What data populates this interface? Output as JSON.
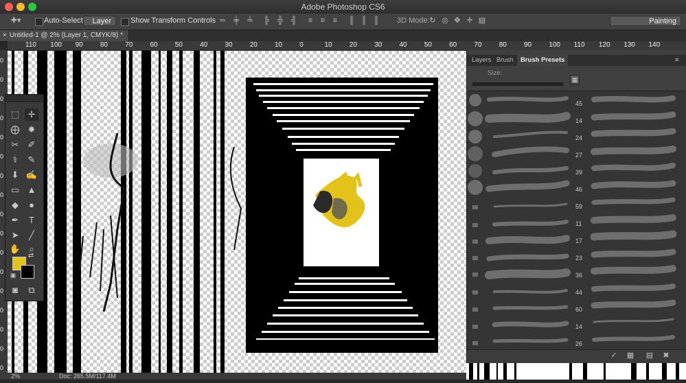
{
  "window": {
    "title": "Adobe Photoshop CS6"
  },
  "options_bar": {
    "auto_select_label": "Auto-Select:",
    "auto_select_value": "Layer",
    "show_transform_label": "Show Transform Controls",
    "mode_3d_label": "3D Mode:",
    "workspace_value": "Painting"
  },
  "document_tab": {
    "label": "Untitled-1 @ 2% (Layer 1, CMYK/8) *"
  },
  "ruler_top": {
    "ticks": [
      "110",
      "100",
      "90",
      "80",
      "70",
      "60",
      "50",
      "40",
      "30",
      "20",
      "10",
      "0",
      "10",
      "20",
      "30",
      "40",
      "50",
      "60",
      "70",
      "80",
      "90",
      "100",
      "110",
      "120",
      "130",
      "140"
    ]
  },
  "ruler_left": {
    "ticks": [
      "0",
      "0",
      "0",
      "0",
      "0",
      "0",
      "0",
      "0",
      "0",
      "0",
      "0",
      "0",
      "0",
      "0",
      "0",
      "0",
      "0"
    ]
  },
  "panel": {
    "tabs": [
      "Layers",
      "Brush",
      "Brush Presets"
    ],
    "active_tab": "Brush Presets",
    "size_label": "Size:",
    "preset_numbers": [
      "45",
      "14",
      "24",
      "27",
      "39",
      "46",
      "59",
      "11",
      "17",
      "23",
      "36",
      "44",
      "60",
      "14",
      "26"
    ]
  },
  "status_bar": {
    "zoom": "2%",
    "doc_info": "Doc: 265.5M/117.4M"
  },
  "colors": {
    "foreground": "#e3c21a",
    "background": "#000000",
    "accent": "#e3c21a"
  }
}
